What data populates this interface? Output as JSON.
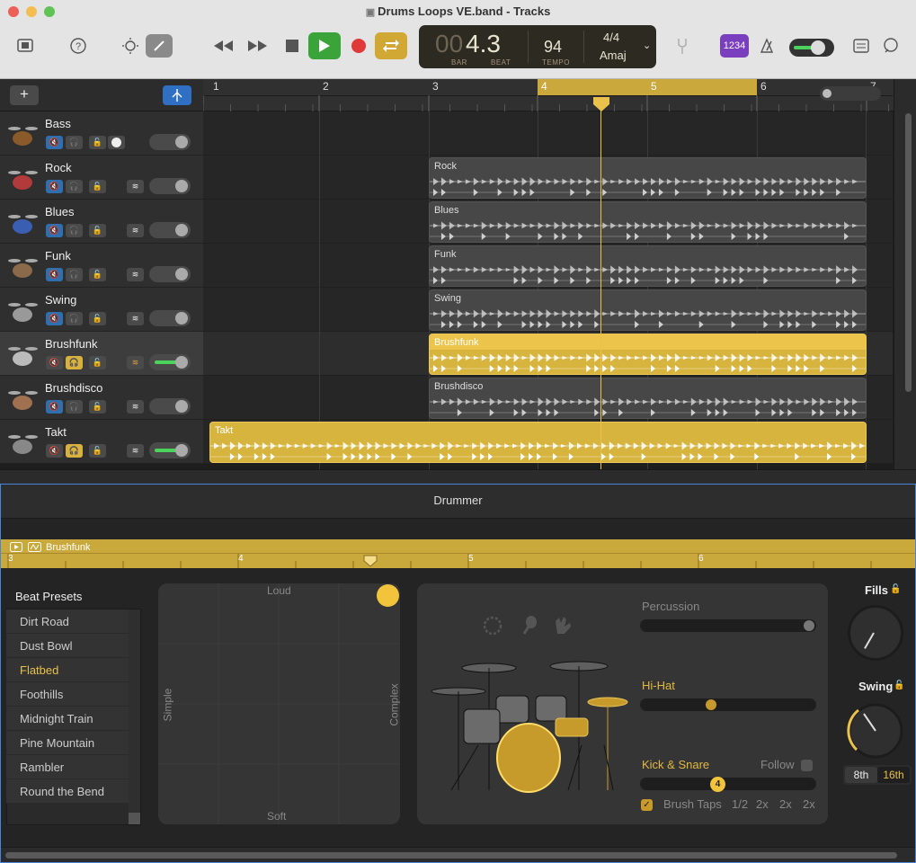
{
  "window": {
    "title": "Drums Loops VE.band - Tracks"
  },
  "toolbar": {
    "icons": [
      "library-icon",
      "help-icon",
      "brightness-icon",
      "pencil-icon"
    ],
    "lcd": {
      "bar_prefix": "00",
      "position": "4.3",
      "bar_label": "BAR",
      "beat_label": "BEAT",
      "tempo": "94",
      "tempo_label": "TEMPO",
      "signature": "4/4",
      "key": "Amaj"
    },
    "count_in": "1234"
  },
  "ruler": {
    "bars": [
      "1",
      "2",
      "3",
      "4",
      "5",
      "6",
      "7"
    ]
  },
  "tracks": [
    {
      "name": "Bass"
    },
    {
      "name": "Rock"
    },
    {
      "name": "Blues"
    },
    {
      "name": "Funk"
    },
    {
      "name": "Swing"
    },
    {
      "name": "Brushfunk"
    },
    {
      "name": "Brushdisco"
    },
    {
      "name": "Takt"
    }
  ],
  "regions": [
    {
      "label": "Rock"
    },
    {
      "label": "Blues"
    },
    {
      "label": "Funk"
    },
    {
      "label": "Swing"
    },
    {
      "label": "Brushfunk"
    },
    {
      "label": "Brushdisco"
    },
    {
      "label": "Takt"
    }
  ],
  "drummer": {
    "title": "Drummer",
    "region_name": "Brushfunk",
    "ruler_bars": [
      "3",
      "4",
      "5",
      "6"
    ],
    "beat_presets_title": "Beat Presets",
    "presets": [
      "Dirt Road",
      "Dust Bowl",
      "Flatbed",
      "Foothills",
      "Midnight Train",
      "Pine Mountain",
      "Rambler",
      "Round the Bend"
    ],
    "active_preset": "Flatbed",
    "xy": {
      "top": "Loud",
      "bottom": "Soft",
      "left": "Simple",
      "right": "Complex"
    },
    "percussion_label": "Percussion",
    "hihat_label": "Hi-Hat",
    "kick_label": "Kick & Snare",
    "follow_label": "Follow",
    "kick_value": "4",
    "brush_taps_label": "Brush Taps",
    "brush_options": [
      "1/2",
      "2x",
      "2x",
      "2x"
    ],
    "fills_label": "Fills",
    "swing_label": "Swing",
    "swing_8th": "8th",
    "swing_16th": "16th"
  }
}
